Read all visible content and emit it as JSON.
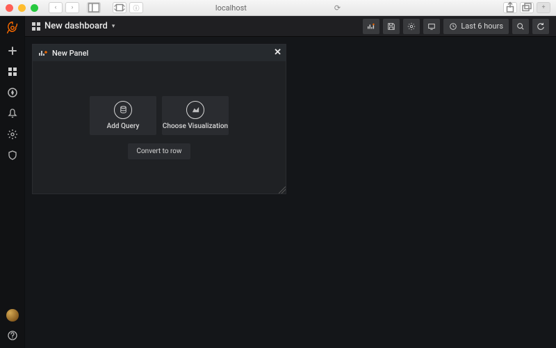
{
  "browser": {
    "url": "localhost"
  },
  "topbar": {
    "dashboard_title": "New dashboard",
    "time_range": "Last 6 hours"
  },
  "panel": {
    "title": "New Panel",
    "add_query_label": "Add Query",
    "choose_viz_label": "Choose Visualization",
    "convert_label": "Convert to row"
  }
}
